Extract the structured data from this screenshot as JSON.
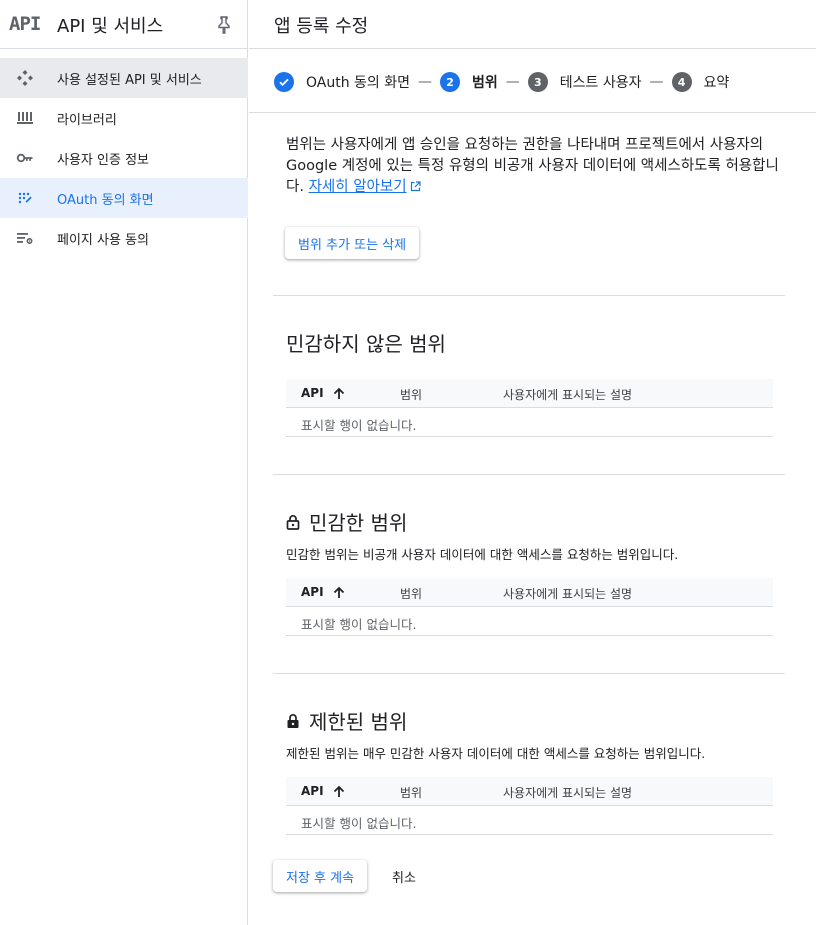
{
  "sidebar": {
    "logo": "API",
    "title": "API 및 서비스",
    "items": [
      {
        "label": "사용 설정된 API 및 서비스",
        "icon": "api-diamond-icon"
      },
      {
        "label": "라이브러리",
        "icon": "library-icon"
      },
      {
        "label": "사용자 인증 정보",
        "icon": "key-icon"
      },
      {
        "label": "OAuth 동의 화면",
        "icon": "oauth-consent-icon"
      },
      {
        "label": "페이지 사용 동의",
        "icon": "page-usage-settings-icon"
      }
    ]
  },
  "header": {
    "title": "앱 등록 수정"
  },
  "stepper": {
    "steps": [
      {
        "number": "",
        "label": "OAuth 동의 화면",
        "state": "done"
      },
      {
        "number": "2",
        "label": "범위",
        "state": "current"
      },
      {
        "number": "3",
        "label": "테스트 사용자",
        "state": "pending"
      },
      {
        "number": "4",
        "label": "요약",
        "state": "pending"
      }
    ],
    "separator": "—"
  },
  "intro": {
    "text": "범위는 사용자에게 앱 승인을 요청하는 권한을 나타내며 프로젝트에서 사용자의 Google 계정에 있는 특정 유형의 비공개 사용자 데이터에 액세스하도록 허용합니다. ",
    "link": "자세히 알아보기"
  },
  "add_scope_button": "범위 추가 또는 삭제",
  "sections": [
    {
      "title": "민감하지 않은 범위",
      "description": "",
      "columns": [
        "API",
        "범위",
        "사용자에게 표시되는 설명"
      ],
      "empty": "표시할 행이 없습니다."
    },
    {
      "title": "민감한 범위",
      "description": "민감한 범위는 비공개 사용자 데이터에 대한 액세스를 요청하는 범위입니다.",
      "columns": [
        "API",
        "범위",
        "사용자에게 표시되는 설명"
      ],
      "empty": "표시할 행이 없습니다."
    },
    {
      "title": "제한된 범위",
      "description": "제한된 범위는 매우 민감한 사용자 데이터에 대한 액세스를 요청하는 범위입니다.",
      "columns": [
        "API",
        "범위",
        "사용자에게 표시되는 설명"
      ],
      "empty": "표시할 행이 없습니다."
    }
  ],
  "footer": {
    "save_label": "저장 후 계속",
    "cancel_label": "취소"
  },
  "colors": {
    "accent": "#1a73e8",
    "active_nav_bg": "#e8f0fe",
    "hover_nav_bg": "#e8eaed",
    "divider": "#dadce0",
    "step_pending": "#5f6368"
  }
}
